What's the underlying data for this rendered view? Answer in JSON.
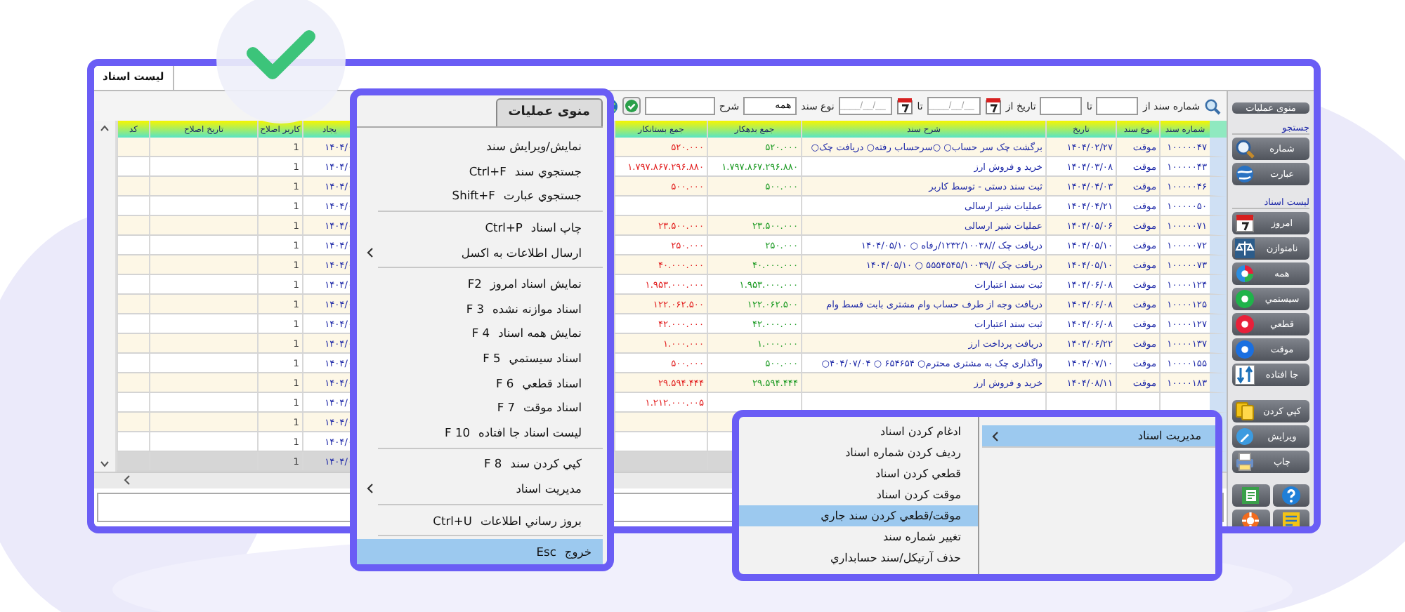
{
  "window": {
    "tab": {
      "label": "لیست اسناد",
      "selected": true
    }
  },
  "toolbar": [
    {
      "kind": "search-button"
    },
    {
      "kind": "label",
      "text": "شماره سند از"
    },
    {
      "kind": "input"
    },
    {
      "kind": "label",
      "text": "تا"
    },
    {
      "kind": "input"
    },
    {
      "kind": "label",
      "text": "تاریخ از"
    },
    {
      "kind": "calendar"
    },
    {
      "kind": "date",
      "placeholder": "____/__/__"
    },
    {
      "kind": "label",
      "text": "تا"
    },
    {
      "kind": "calendar"
    },
    {
      "kind": "date",
      "placeholder": "____/__/__"
    },
    {
      "kind": "label",
      "text": "نوع سند"
    },
    {
      "kind": "select",
      "value": "همه"
    },
    {
      "kind": "label",
      "text": "شرح"
    },
    {
      "kind": "input"
    },
    {
      "kind": "ok-button"
    },
    {
      "kind": "globe-button"
    }
  ],
  "table": {
    "columns": [
      {
        "label": "شماره سند"
      },
      {
        "label": "نوع سند"
      },
      {
        "label": "تاریخ"
      },
      {
        "label": "شرح سند"
      },
      {
        "label": "جمع بدهکار"
      },
      {
        "label": "جمع بستانکار"
      },
      {
        "label": "یجاد"
      },
      {
        "label": "کاربر اصلاح"
      },
      {
        "label": "تاریخ اصلاح"
      },
      {
        "label": "کد"
      }
    ],
    "rows": [
      {
        "selected": false,
        "modified_by": "1",
        "created": "۱۴۰۴/۰",
        "credit": "۵۲۰.۰۰۰",
        "debit": "۵۲۰.۰۰۰",
        "description": "○برگشت چک سر حساب○ ○سرحساب رفته○ دریافت چک",
        "date": "۱۴۰۴/۰۲/۲۷",
        "type": "موقت",
        "number": "۱۰۰۰۰۰۴۷"
      },
      {
        "selected": false,
        "modified_by": "1",
        "created": "۱۴۰۴/۰",
        "credit": "۱.۷۹۷.۸۶۷.۲۹۶.۸۸۰",
        "debit": "۱.۷۹۷.۸۶۷.۲۹۶.۸۸۰",
        "description": "خرید و فروش ارز",
        "date": "۱۴۰۴/۰۳/۰۸",
        "type": "موقت",
        "number": "۱۰۰۰۰۰۴۳"
      },
      {
        "selected": false,
        "modified_by": "1",
        "created": "۱۴۰۴/۰",
        "credit": "۵۰۰.۰۰۰",
        "debit": "۵۰۰.۰۰۰",
        "description": "ثبت سند دستی - توسط کاربر",
        "date": "۱۴۰۴/۰۴/۰۳",
        "type": "موقت",
        "number": "۱۰۰۰۰۰۴۶"
      },
      {
        "selected": false,
        "modified_by": "1",
        "created": "۱۴۰۴/۰",
        "description": "عملیات شیر ارسالی",
        "date": "۱۴۰۴/۰۴/۲۱",
        "type": "موقت",
        "number": "۱۰۰۰۰۰۵۰"
      },
      {
        "selected": false,
        "modified_by": "1",
        "created": "۱۴۰۴/۰",
        "credit": "۲۳.۵۰۰.۰۰۰",
        "debit": "۲۳.۵۰۰.۰۰۰",
        "description": "عملیات شیر ارسالی",
        "date": "۱۴۰۴/۰۵/۰۶",
        "type": "موقت",
        "number": "۱۰۰۰۰۰۷۱"
      },
      {
        "selected": false,
        "modified_by": "1",
        "created": "۱۴۰۴/۰",
        "credit": "۲۵۰.۰۰۰",
        "debit": "۲۵۰.۰۰۰",
        "description": "دریافت چک //۱۲۳۲/۱۰۰۳۸/رفاه ○ ۱۴۰۴/۰۵/۱۰",
        "date": "۱۴۰۴/۰۵/۱۰",
        "type": "موقت",
        "number": "۱۰۰۰۰۰۷۲"
      },
      {
        "selected": false,
        "modified_by": "1",
        "created": "۱۴۰۴/۰",
        "credit": "۴۰.۰۰۰.۰۰۰",
        "debit": "۴۰.۰۰۰.۰۰۰",
        "description": "دریافت چک //۵۵۵۴۵۴۵/۱۰۰۳۹ ○ ۱۴۰۴/۰۵/۱۰",
        "date": "۱۴۰۴/۰۵/۱۰",
        "type": "موقت",
        "number": "۱۰۰۰۰۰۷۳"
      },
      {
        "selected": false,
        "modified_by": "1",
        "created": "۱۴۰۴/۰",
        "credit": "۱.۹۵۳.۰۰۰.۰۰۰",
        "debit": "۱.۹۵۳.۰۰۰.۰۰۰",
        "description": "ثبت سند اعتبارات",
        "date": "۱۴۰۴/۰۶/۰۸",
        "type": "موقت",
        "number": "۱۰۰۰۰۱۲۴"
      },
      {
        "selected": false,
        "modified_by": "1",
        "created": "۱۴۰۴/۰",
        "credit": "۱۲۲.۰۶۲.۵۰۰",
        "debit": "۱۲۲.۰۶۲.۵۰۰",
        "description": "دریافت وجه از طرف حساب وام مشتری بابت قسط وام",
        "date": "۱۴۰۴/۰۶/۰۸",
        "type": "موقت",
        "number": "۱۰۰۰۰۱۲۵"
      },
      {
        "selected": false,
        "modified_by": "1",
        "created": "۱۴۰۴/۰",
        "credit": "۴۲.۰۰۰.۰۰۰",
        "debit": "۴۲.۰۰۰.۰۰۰",
        "description": "ثبت سند اعتبارات",
        "date": "۱۴۰۴/۰۶/۰۸",
        "type": "موقت",
        "number": "۱۰۰۰۰۱۲۷"
      },
      {
        "selected": false,
        "modified_by": "1",
        "created": "۱۴۰۴/۰",
        "credit": "۱.۰۰۰.۰۰۰",
        "debit": "۱.۰۰۰.۰۰۰",
        "description": "دریافت پرداخت ارز",
        "date": "۱۴۰۴/۰۶/۲۲",
        "type": "موقت",
        "number": "۱۰۰۰۰۱۳۷"
      },
      {
        "selected": false,
        "modified_by": "1",
        "created": "۱۴۰۴/۰",
        "credit": "۵۰۰.۰۰۰",
        "debit": "۵۰۰.۰۰۰",
        "description": "○واگذاری چک به مشتری محترم○ ۶۵۴۶۵۴ ○ ۴۰۴/۰۷/۰۴",
        "date": "۱۴۰۴/۰۷/۱۰",
        "type": "موقت",
        "number": "۱۰۰۰۰۱۵۵"
      },
      {
        "selected": false,
        "modified_by": "1",
        "created": "۱۴۰۴/۰",
        "credit": "۲۹.۵۹۴.۴۴۴",
        "debit": "۲۹.۵۹۴.۴۴۴",
        "description": "خرید و فروش ارز",
        "date": "۱۴۰۴/۰۸/۱۱",
        "type": "موقت",
        "number": "۱۰۰۰۰۱۸۳"
      },
      {
        "selected": false,
        "modified_by": "1",
        "created": "۱۴۰۴/۰",
        "credit": "۱.۲۱۲.۰۰۰.۰۰۵"
      },
      {
        "selected": false,
        "modified_by": "1",
        "created": "۱۴۰۴/۰"
      },
      {
        "selected": false,
        "modified_by": "1",
        "created": "۱۴۰۴/۰"
      },
      {
        "selected": true,
        "modified_by": "1",
        "created": "۱۴۰۴/۰"
      }
    ]
  },
  "sidebar": {
    "menu_button": "منوی عملیات",
    "sections": [
      {
        "title": "جستجو",
        "buttons": [
          {
            "label": "شماره",
            "kind": "search-number"
          },
          {
            "label": "عبارت",
            "kind": "search-text"
          }
        ]
      },
      {
        "title": "لیست اسناد",
        "buttons": [
          {
            "label": "امروز",
            "kind": "calendar"
          },
          {
            "label": "نامتوازن",
            "kind": "scale"
          },
          {
            "label": "همه",
            "kind": "pie"
          },
          {
            "label": "سيستمي",
            "kind": "dot",
            "color": "#1fb34a"
          },
          {
            "label": "قطعي",
            "kind": "dot",
            "color": "#e8203a"
          },
          {
            "label": "موقت",
            "kind": "dot",
            "color": "#1a6fe0"
          },
          {
            "label": "جا افتاده",
            "kind": "swap"
          }
        ]
      },
      {
        "buttons": [
          {
            "label": "کپي کردن",
            "kind": "copy"
          },
          {
            "label": "ويرايش",
            "kind": "edit"
          },
          {
            "label": "چاپ",
            "kind": "print"
          }
        ]
      }
    ],
    "tool_buttons": [
      {
        "kind": "document"
      },
      {
        "kind": "help"
      },
      {
        "kind": "lifebuoy"
      },
      {
        "kind": "notes"
      }
    ]
  },
  "operations_menu": {
    "title": "منوی عملیات",
    "items": [
      {
        "label": "نمایش/ویرایش سند",
        "selected": false,
        "submenu": false,
        "separator_after": false
      },
      {
        "label": "جستجوي سند",
        "shortcut": "Ctrl+F",
        "selected": false,
        "submenu": false,
        "separator_after": false
      },
      {
        "label": "جستجوي عبارت",
        "shortcut": "Shift+F",
        "selected": false,
        "submenu": false,
        "separator_after": true
      },
      {
        "label": "چاپ اسناد",
        "shortcut": "Ctrl+P",
        "selected": false,
        "submenu": false,
        "separator_after": false
      },
      {
        "label": "ارسال اطلاعات به اکسل",
        "selected": false,
        "submenu": true,
        "separator_after": true
      },
      {
        "label": "نمایش اسناد امروز",
        "shortcut": "F2",
        "selected": false,
        "submenu": false,
        "separator_after": false
      },
      {
        "label": "اسناد موازنه نشده",
        "shortcut": "F 3",
        "selected": false,
        "submenu": false,
        "separator_after": false
      },
      {
        "label": "نمایش همه اسناد",
        "shortcut": "F 4",
        "selected": false,
        "submenu": false,
        "separator_after": false
      },
      {
        "label": "اسناد سيستمي",
        "shortcut": "F 5",
        "selected": false,
        "submenu": false,
        "separator_after": false
      },
      {
        "label": "اسناد قطعي",
        "shortcut": "F 6",
        "selected": false,
        "submenu": false,
        "separator_after": false
      },
      {
        "label": "اسناد موقت",
        "shortcut": "F 7",
        "selected": false,
        "submenu": false,
        "separator_after": false
      },
      {
        "label": "ليست اسناد جا افتاده",
        "shortcut": "F 10",
        "selected": false,
        "submenu": false,
        "separator_after": true
      },
      {
        "label": "کپي کردن سند",
        "shortcut": "F 8",
        "selected": false,
        "submenu": false,
        "separator_after": false
      },
      {
        "label": "مديريت اسناد",
        "selected": false,
        "submenu": true,
        "separator_after": true
      },
      {
        "label": "بروز رساني اطلاعات",
        "shortcut": "Ctrl+U",
        "selected": false,
        "submenu": false,
        "separator_after": true
      },
      {
        "label": "خروج",
        "shortcut": "Esc",
        "selected": true,
        "submenu": false,
        "separator_after": false
      }
    ]
  },
  "documents_submenu": {
    "parent": {
      "label": "مديريت اسناد",
      "selected": true,
      "submenu": true
    },
    "items": [
      {
        "label": "ادغام کردن اسناد",
        "selected": false
      },
      {
        "label": "رديف کردن شماره اسناد",
        "selected": false
      },
      {
        "label": "قطعي کردن اسناد",
        "selected": false
      },
      {
        "label": "موقت کردن اسناد",
        "selected": false
      },
      {
        "label": "موقت/قطعي کردن سند جاري",
        "selected": true
      },
      {
        "label": "تغيير شماره سند",
        "selected": false
      },
      {
        "label": "حذف آرتيکل/سند حسابداري",
        "selected": false
      }
    ]
  }
}
